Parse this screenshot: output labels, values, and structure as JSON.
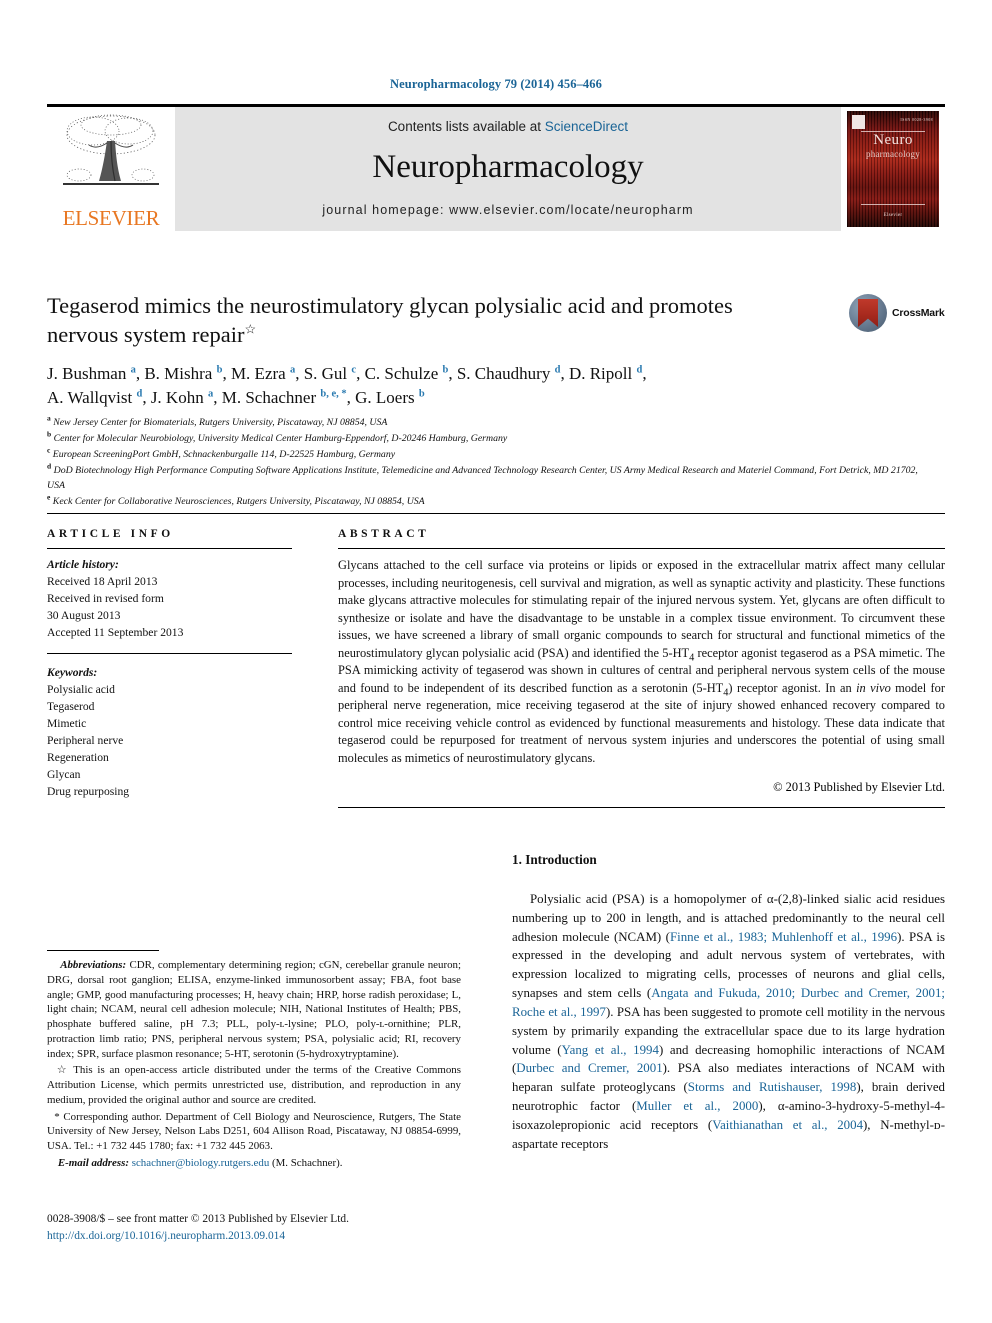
{
  "running_head": "Neuropharmacology 79 (2014) 456–466",
  "masthead": {
    "contents_prefix": "Contents lists available at ",
    "contents_link": "ScienceDirect",
    "journal_name": "Neuropharmacology",
    "homepage": "journal homepage: www.elsevier.com/locate/neuropharm",
    "publisher_logo_text": "ELSEVIER",
    "cover": {
      "title_line1": "Neuro",
      "title_line2": "pharmacology",
      "bottom_text": "Elsevier",
      "topright_text": "ISSN 0028-3908",
      "accent_color": "#8c1a12"
    }
  },
  "article": {
    "title": "Tegaserod mimics the neurostimulatory glycan polysialic acid and promotes nervous system repair",
    "title_marker": "☆",
    "crossmark_label": "CrossMark",
    "authors": [
      {
        "name": "J. Bushman",
        "marks": "a"
      },
      {
        "name": "B. Mishra",
        "marks": "b"
      },
      {
        "name": "M. Ezra",
        "marks": "a"
      },
      {
        "name": "S. Gul",
        "marks": "c"
      },
      {
        "name": "C. Schulze",
        "marks": "b"
      },
      {
        "name": "S. Chaudhury",
        "marks": "d"
      },
      {
        "name": "D. Ripoll",
        "marks": "d"
      },
      {
        "name": "A. Wallqvist",
        "marks": "d"
      },
      {
        "name": "J. Kohn",
        "marks": "a"
      },
      {
        "name": "M. Schachner",
        "marks": "b, e, *"
      },
      {
        "name": "G. Loers",
        "marks": "b"
      }
    ],
    "affiliations": [
      {
        "mark": "a",
        "text": "New Jersey Center for Biomaterials, Rutgers University, Piscataway, NJ 08854, USA"
      },
      {
        "mark": "b",
        "text": "Center for Molecular Neurobiology, University Medical Center Hamburg-Eppendorf, D-20246 Hamburg, Germany"
      },
      {
        "mark": "c",
        "text": "European ScreeningPort GmbH, Schnackenburgalle 114, D-22525 Hamburg, Germany"
      },
      {
        "mark": "d",
        "text": "DoD Biotechnology High Performance Computing Software Applications Institute, Telemedicine and Advanced Technology Research Center, US Army Medical Research and Materiel Command, Fort Detrick, MD 21702, USA"
      },
      {
        "mark": "e",
        "text": "Keck Center for Collaborative Neurosciences, Rutgers University, Piscataway, NJ 08854, USA"
      }
    ]
  },
  "article_info": {
    "heading": "ARTICLE INFO",
    "history_label": "Article history:",
    "history": [
      "Received 18 April 2013",
      "Received in revised form",
      "30 August 2013",
      "Accepted 11 September 2013"
    ],
    "keywords_label": "Keywords:",
    "keywords": [
      "Polysialic acid",
      "Tegaserod",
      "Mimetic",
      "Peripheral nerve",
      "Regeneration",
      "Glycan",
      "Drug repurposing"
    ]
  },
  "abstract": {
    "heading": "ABSTRACT",
    "text_part1": "Glycans attached to the cell surface via proteins or lipids or exposed in the extracellular matrix affect many cellular processes, including neuritogenesis, cell survival and migration, as well as synaptic activity and plasticity. These functions make glycans attractive molecules for stimulating repair of the injured nervous system. Yet, glycans are often difficult to synthesize or isolate and have the disadvantage to be unstable in a complex tissue environment. To circumvent these issues, we have screened a library of small organic compounds to search for structural and functional mimetics of the neurostimulatory glycan polysialic acid (PSA) and identified the 5-HT",
    "sub1": "4",
    "text_part2": " receptor agonist tegaserod as a PSA mimetic. The PSA mimicking activity of tegaserod was shown in cultures of central and peripheral nervous system cells of the mouse and found to be independent of its described function as a serotonin (5-HT",
    "sub2": "4",
    "text_part3": ") receptor agonist. In an ",
    "italic1": "in vivo",
    "text_part4": " model for peripheral nerve regeneration, mice receiving tegaserod at the site of injury showed enhanced recovery compared to control mice receiving vehicle control as evidenced by functional measurements and histology. These data indicate that tegaserod could be repurposed for treatment of nervous system injuries and underscores the potential of using small molecules as mimetics of neurostimulatory glycans.",
    "copyright": "© 2013 Published by Elsevier Ltd."
  },
  "footnotes": {
    "abbreviations_label": "Abbreviations:",
    "abbreviations_text": " CDR, complementary determining region; cGN, cerebellar granule neuron; DRG, dorsal root ganglion; ELISA, enzyme-linked immunosorbent assay; FBA, foot base angle; GMP, good manufacturing processes; H, heavy chain; HRP, horse radish peroxidase; L, light chain; NCAM, neural cell adhesion molecule; NIH, National Institutes of Health; PBS, phosphate buffered saline, pH 7.3; PLL, poly-ʟ-lysine; PLO, poly-ʟ-ornithine; PLR, protraction limb ratio; PNS, peripheral nervous system; PSA, polysialic acid; RI, recovery index; SPR, surface plasmon resonance; 5-HT, serotonin (5-hydroxytryptamine).",
    "open_access_marker": "☆",
    "open_access_text": " This is an open-access article distributed under the terms of the Creative Commons Attribution License, which permits unrestricted use, distribution, and reproduction in any medium, provided the original author and source are credited.",
    "corresponding_marker": "*",
    "corresponding_text": " Corresponding author. Department of Cell Biology and Neuroscience, Rutgers, The State University of New Jersey, Nelson Labs D251, 604 Allison Road, Piscataway, NJ 08854-6999, USA. Tel.: +1 732 445 1780; fax: +1 732 445 2063.",
    "email_label": "E-mail address:",
    "email": "schachner@biology.rutgers.edu",
    "email_suffix": " (M. Schachner)."
  },
  "footer": {
    "issn_line": "0028-3908/$ – see front matter © 2013 Published by Elsevier Ltd.",
    "doi": "http://dx.doi.org/10.1016/j.neuropharm.2013.09.014"
  },
  "introduction": {
    "heading": "1. Introduction",
    "p1_a": "Polysialic acid (PSA) is a homopolymer of α-(2,8)-linked sialic acid residues numbering up to 200 in length, and is attached predominantly to the neural cell adhesion molecule (NCAM) (",
    "cite1": "Finne et al., 1983; Muhlenhoff et al., 1996",
    "p1_b": "). PSA is expressed in the developing and adult nervous system of vertebrates, with expression localized to migrating cells, processes of neurons and glial cells, synapses and stem cells (",
    "cite2": "Angata and Fukuda, 2010; Durbec and Cremer, 2001; Roche et al., 1997",
    "p1_c": "). PSA has been suggested to promote cell motility in the nervous system by primarily expanding the extracellular space due to its large hydration volume (",
    "cite3": "Yang et al., 1994",
    "p1_d": ") and decreasing homophilic interactions of NCAM (",
    "cite4": "Durbec and Cremer, 2001",
    "p1_e": "). PSA also mediates interactions of NCAM with heparan sulfate proteoglycans (",
    "cite5": "Storms and Rutishauser, 1998",
    "p1_f": "), brain derived neurotrophic factor (",
    "cite6": "Muller et al., 2000",
    "p1_g": "), α-amino-3-hydroxy-5-methyl-4-isoxazolepropionic acid receptors (",
    "cite7": "Vaithianathan et al., 2004",
    "p1_h": "), N-methyl-ᴅ-aspartate receptors"
  },
  "colors": {
    "link_blue": "#1a6496",
    "cite_blue": "#1a6496",
    "elsevier_orange": "#E87722",
    "masthead_gray": "#e3e3e3"
  }
}
